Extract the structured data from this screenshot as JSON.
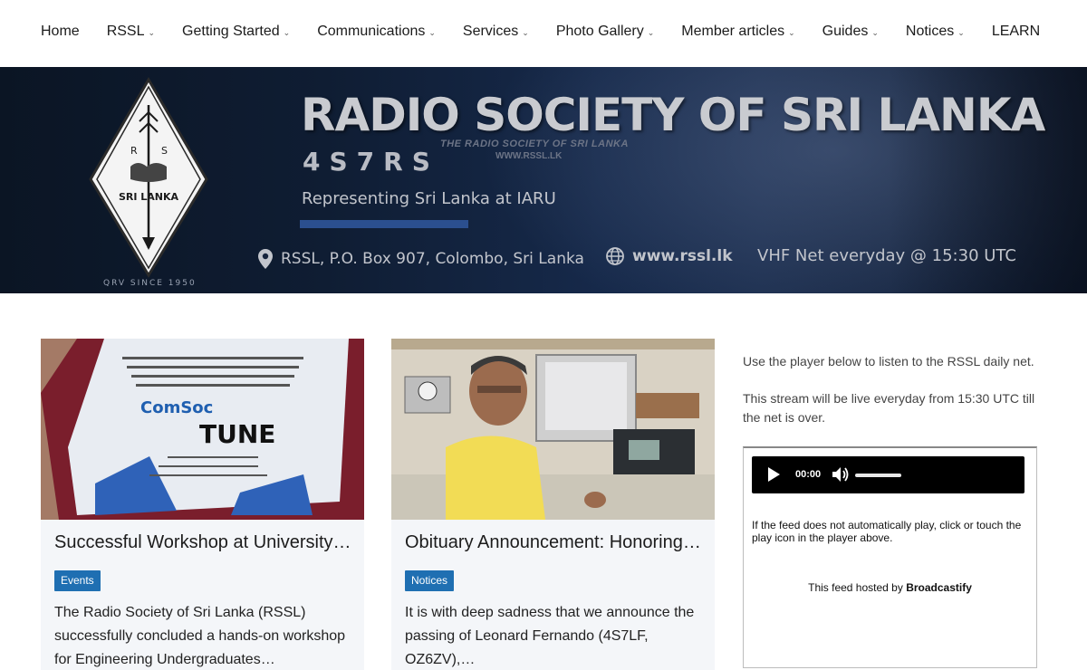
{
  "nav": {
    "items": [
      {
        "label": "Home",
        "dropdown": false
      },
      {
        "label": "RSSL",
        "dropdown": true
      },
      {
        "label": "Getting Started",
        "dropdown": true
      },
      {
        "label": "Communications",
        "dropdown": true
      },
      {
        "label": "Services",
        "dropdown": true
      },
      {
        "label": "Photo Gallery",
        "dropdown": true
      },
      {
        "label": "Member articles",
        "dropdown": true
      },
      {
        "label": "Guides",
        "dropdown": true
      },
      {
        "label": "Notices",
        "dropdown": true
      },
      {
        "label": "LEARN",
        "dropdown": false
      }
    ],
    "chevron": "⌄"
  },
  "banner": {
    "title": "RADIO SOCIETY OF SRI LANKA",
    "callsign": "4S7RS",
    "faint_line1": "THE RADIO SOCIETY OF SRI LANKA",
    "faint_line2": "WWW.RSSL.LK",
    "subtitle": "Representing Sri Lanka at IARU",
    "address": "RSSL, P.O. Box 907, Colombo, Sri Lanka",
    "website": "www.rssl.lk",
    "net": "VHF Net everyday @ 15:30 UTC",
    "logo_r": "R",
    "logo_s": "S",
    "logo_country": "SRI LANKA",
    "since": "QRV SINCE 1950"
  },
  "cards": [
    {
      "title": "Successful Workshop at University …",
      "badge": "Events",
      "excerpt": "The Radio Society of Sri Lanka (RSSL) successfully concluded a hands-on workshop for Engineering Undergraduates…",
      "image": "certificate-photo"
    },
    {
      "title": "Obituary Announcement: Honoring …",
      "badge": "Notices",
      "excerpt": "It is with deep sadness that we announce the passing of Leonard Fernando (4S7LF, OZ6ZV),…",
      "image": "radio-station-portrait"
    }
  ],
  "sidebar": {
    "intro": "Use the player below to listen to the RSSL daily net.",
    "schedule": "This stream will be live everyday from 15:30 UTC till the net is over.",
    "player": {
      "time": "00:00",
      "volume": 0.9
    },
    "feed_note": "If the feed does not automatically play, click or touch the play icon in the player above.",
    "host_prefix": "This feed hosted by ",
    "host_name": "Broadcastify"
  },
  "colors": {
    "badge": "#1f6fb2",
    "banner_bg": "#0f1d33",
    "card_bg": "#f4f6f9"
  }
}
